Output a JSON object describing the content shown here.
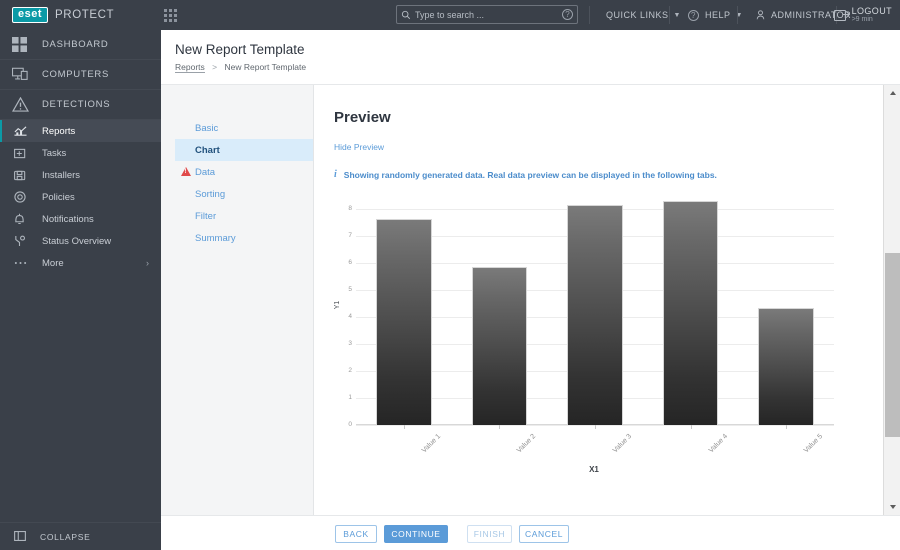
{
  "topbar": {
    "logo_text": "eset",
    "brand": "PROTECT",
    "apps_icon": "apps-grid-icon",
    "search": {
      "placeholder": "Type to search ...",
      "value": "",
      "icon": "search-icon",
      "help_icon": "question-circle-icon"
    },
    "quick_links": "QUICK LINKS",
    "help": "HELP",
    "administrator": "ADMINISTRATOR",
    "logout": "LOGOUT",
    "session_time": ">9 min"
  },
  "sidebar": {
    "primary_items": [
      {
        "label": "DASHBOARD",
        "icon": "dashboard-grid-icon"
      },
      {
        "label": "COMPUTERS",
        "icon": "computer-icon"
      },
      {
        "label": "DETECTIONS",
        "icon": "warning-triangle-icon"
      }
    ],
    "secondary_items": [
      {
        "label": "Reports",
        "icon": "chart-icon",
        "active": true
      },
      {
        "label": "Tasks",
        "icon": "tasks-icon",
        "active": false
      },
      {
        "label": "Installers",
        "icon": "installers-icon",
        "active": false
      },
      {
        "label": "Policies",
        "icon": "policies-icon",
        "active": false
      },
      {
        "label": "Notifications",
        "icon": "bell-icon",
        "active": false
      },
      {
        "label": "Status Overview",
        "icon": "status-icon",
        "active": false
      },
      {
        "label": "More",
        "icon": "ellipsis-icon",
        "active": false
      }
    ],
    "collapse": {
      "label": "COLLAPSE",
      "icon": "collapse-panel-icon"
    }
  },
  "page": {
    "title": "New Report Template",
    "breadcrumb_root": "Reports",
    "breadcrumb_sep": ">",
    "breadcrumb_current": "New Report Template"
  },
  "wizard": {
    "steps": [
      {
        "label": "Basic",
        "active": false,
        "warning": false
      },
      {
        "label": "Chart",
        "active": true,
        "warning": false
      },
      {
        "label": "Data",
        "active": false,
        "warning": true
      },
      {
        "label": "Sorting",
        "active": false,
        "warning": false
      },
      {
        "label": "Filter",
        "active": false,
        "warning": false
      },
      {
        "label": "Summary",
        "active": false,
        "warning": false
      }
    ]
  },
  "preview": {
    "heading": "Preview",
    "hide_link": "Hide Preview",
    "info_icon": "info-icon",
    "info_message": "Showing randomly generated data. Real data preview can be displayed in the following tabs."
  },
  "chart_data": {
    "type": "bar",
    "title": "",
    "categories": [
      "Value 1",
      "Value 2",
      "Value 3",
      "Value 4",
      "Value 5"
    ],
    "values": [
      7.65,
      5.85,
      8.15,
      8.3,
      4.35
    ],
    "xlabel": "X1",
    "ylabel": "Y1",
    "yticks": [
      0,
      1,
      2,
      3,
      4,
      5,
      6,
      7,
      8
    ],
    "ylim": [
      0,
      8.6
    ],
    "grid": true,
    "legend": false
  },
  "scrollbar": {
    "up_icon": "scroll-up-arrow-icon",
    "down_icon": "scroll-down-arrow-icon"
  },
  "footer": {
    "back": "BACK",
    "continue": "CONTINUE",
    "finish": "FINISH",
    "cancel": "CANCEL"
  },
  "colors": {
    "accent": "#0b9aa6",
    "primary_button": "#5b9bd8",
    "sidebar_bg": "#3a4049",
    "warning": "#e04a4a"
  }
}
